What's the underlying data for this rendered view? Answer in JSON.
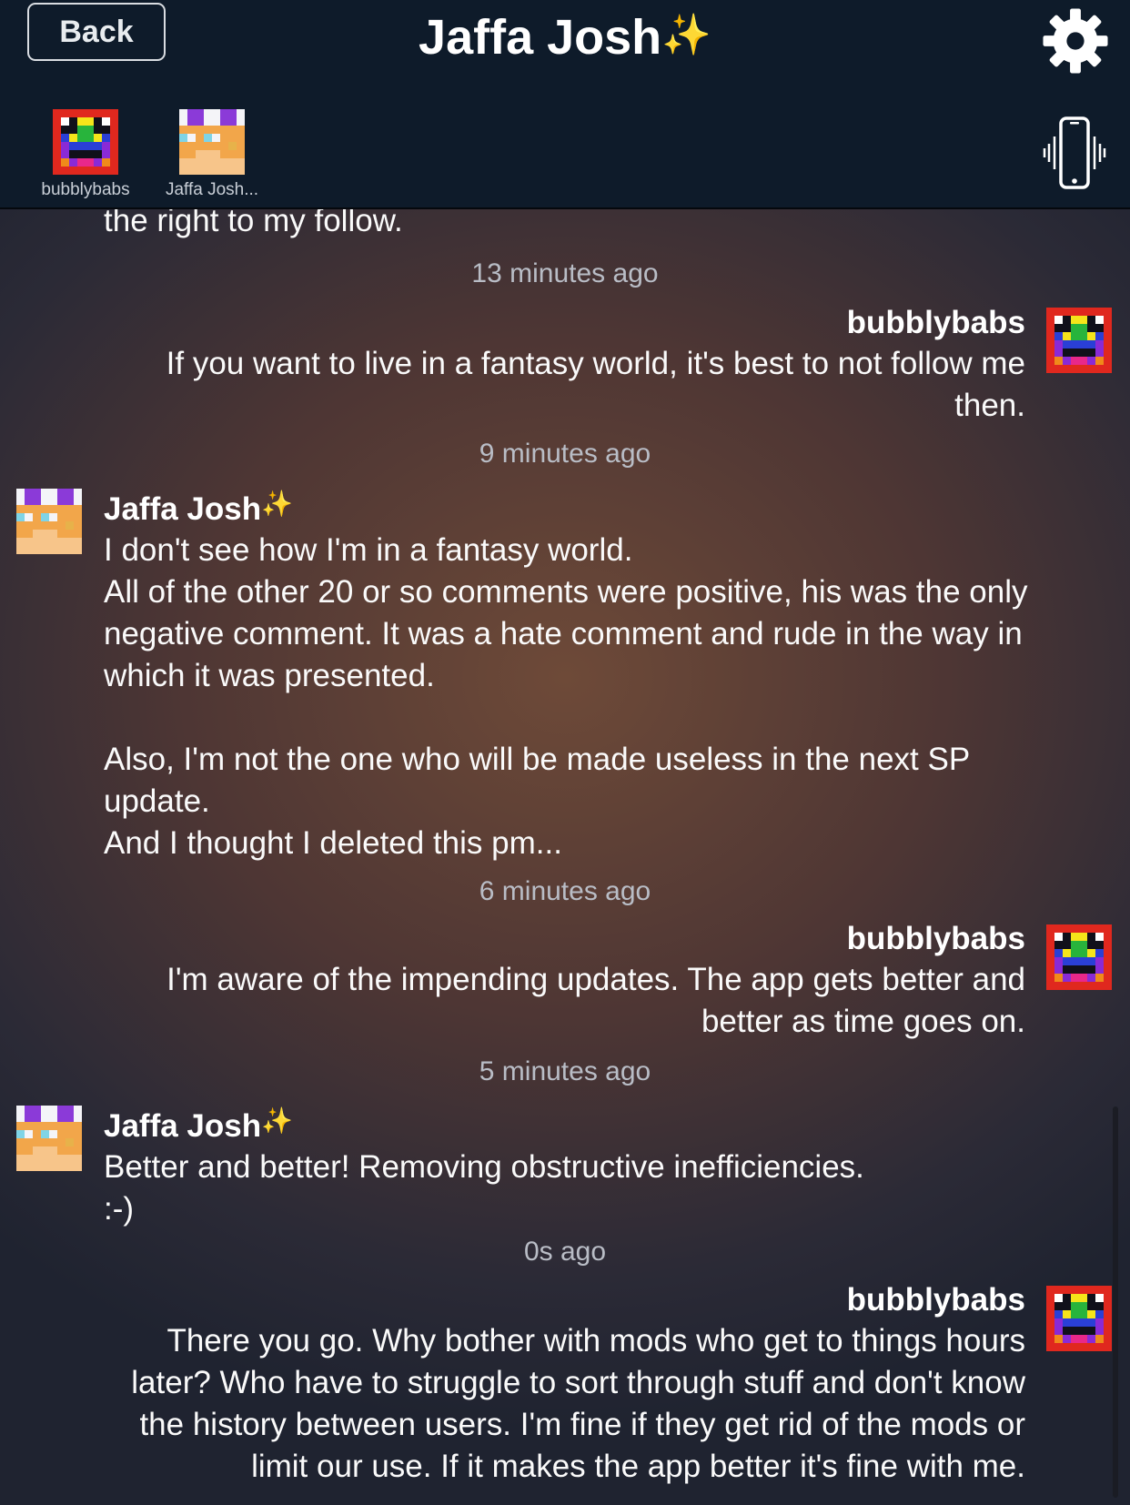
{
  "header": {
    "back_label": "Back",
    "title": "Jaffa Josh",
    "title_sparkle": "✨",
    "participants": [
      {
        "name": "bubblybabs"
      },
      {
        "name": "Jaffa Josh..."
      }
    ]
  },
  "chat": {
    "partial_top_text": "the right to my follow.",
    "timestamps": [
      "13 minutes ago",
      "9 minutes ago",
      "6 minutes ago",
      "5 minutes ago",
      "0s ago"
    ],
    "messages": [
      {
        "sender": "bubblybabs",
        "lines": [
          "If you want to live in a fantasy world, it's best to not follow me",
          "then."
        ]
      },
      {
        "sender": "Jaffa Josh",
        "sparkle": "✨",
        "lines": [
          "I don't see how I'm in a fantasy world.",
          "All of the other 20 or so comments were positive, his was the only",
          "negative comment. It was a hate comment and rude in the way in",
          "which it was presented.",
          "",
          "Also, I'm not the one who will be made useless in the next SP",
          "update.",
          "And I thought I deleted this pm..."
        ]
      },
      {
        "sender": "bubblybabs",
        "lines": [
          "I'm aware of the impending updates.  The app gets better and",
          "better as time goes on."
        ]
      },
      {
        "sender": "Jaffa Josh",
        "sparkle": "✨",
        "lines": [
          "Better and better! Removing obstructive inefficiencies.",
          ":-)"
        ]
      },
      {
        "sender": "bubblybabs",
        "lines": [
          "There you go.  Why bother with mods who get to things hours",
          "later?  Who have to struggle to sort through stuff and don't know",
          "the history between users.  I'm fine if they get rid of the mods or",
          "limit our use.  If it makes the app better it's fine with me."
        ]
      }
    ]
  },
  "icons": {
    "settings": "gear-icon",
    "vibrate": "phone-vibrate-icon",
    "avatar_bubblybabs": "rainbow-pixel-avatar",
    "avatar_jaffa": "orange-pixel-avatar"
  },
  "colors": {
    "header_bg": "#0e1b2a",
    "timestamp": "#b9bdc6"
  }
}
